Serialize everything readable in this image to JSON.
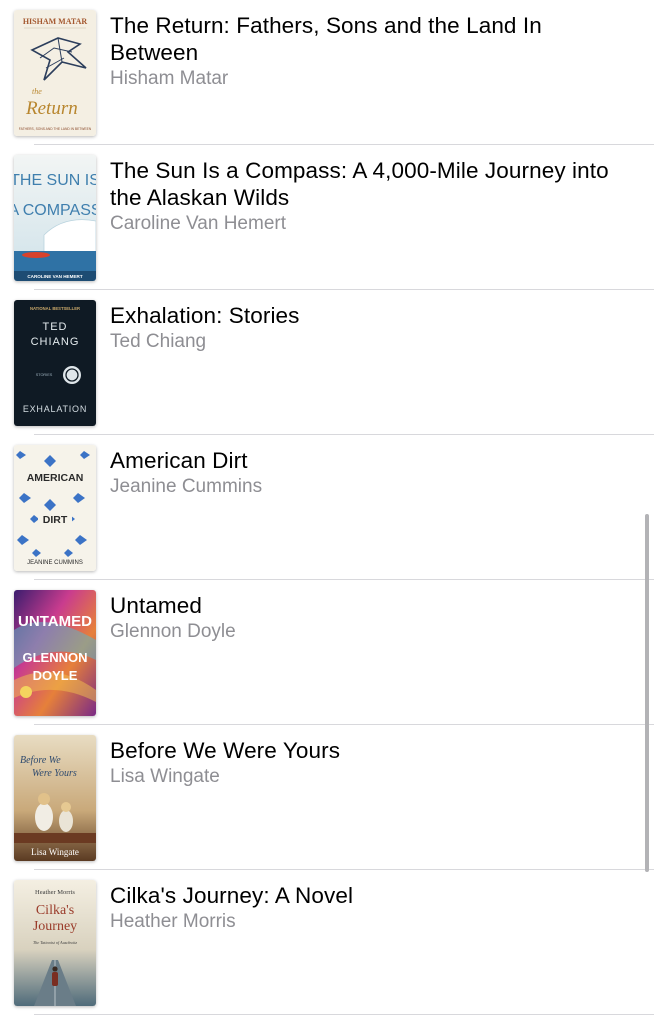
{
  "books": [
    {
      "title": "The Return: Fathers, Sons and the Land In Between",
      "author": "Hisham Matar",
      "cover_text": [
        "HISHAM MATAR",
        "the",
        "Return",
        "FATHERS, SONS AND THE LAND IN BETWEEN"
      ]
    },
    {
      "title": "The Sun Is a Compass: A 4,000-Mile Journey into the Alaskan Wilds",
      "author": "Caroline Van Hemert",
      "cover_text": [
        "THE SUN IS",
        "A COMPASS",
        "CAROLINE VAN HEMERT"
      ]
    },
    {
      "title": "Exhalation: Stories",
      "author": "Ted Chiang",
      "cover_text": [
        "NATIONAL BESTSELLER",
        "TED",
        "CHIANG",
        "STORIES",
        "EXHALATION"
      ]
    },
    {
      "title": "American Dirt",
      "author": "Jeanine Cummins",
      "cover_text": [
        "AMERICAN",
        "DIRT",
        "JEANINE CUMMINS"
      ]
    },
    {
      "title": "Untamed",
      "author": "Glennon Doyle",
      "cover_text": [
        "UNTAMED",
        "GLENNON",
        "DOYLE"
      ]
    },
    {
      "title": "Before We Were Yours",
      "author": "Lisa Wingate",
      "cover_text": [
        "Before We",
        "Were Yours",
        "Lisa Wingate"
      ]
    },
    {
      "title": "Cilka's Journey: A Novel",
      "author": "Heather Morris",
      "cover_text": [
        "Heather Morris",
        "Cilka's",
        "Journey",
        "The Tattooist of Auschwitz"
      ]
    }
  ]
}
